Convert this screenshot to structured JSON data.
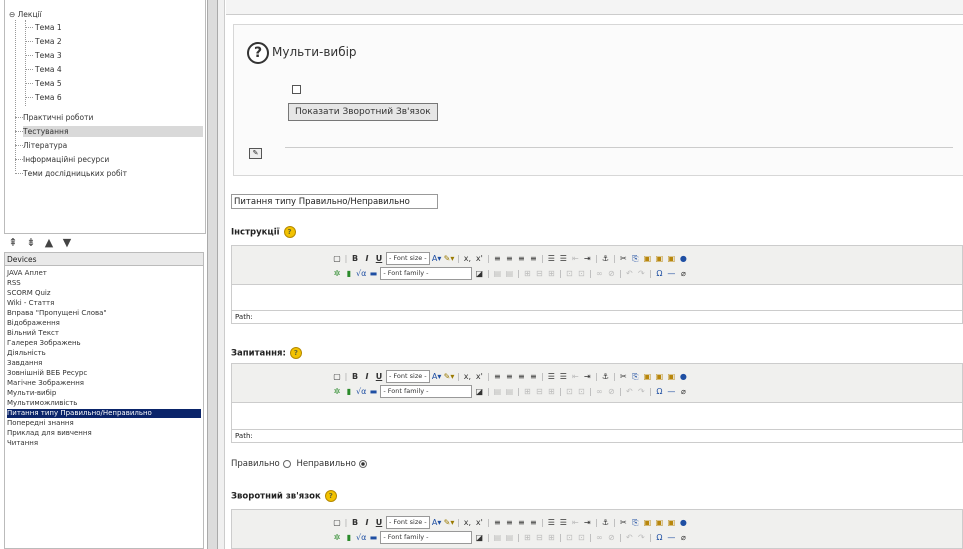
{
  "tree": {
    "root": "Лекції",
    "topics": [
      "Тема 1",
      "Тема 2",
      "Тема 3",
      "Тема 4",
      "Тема 5",
      "Тема 6"
    ],
    "sections": [
      "Практичні роботи",
      "Тестування",
      "Література",
      "Інформаційні ресурси",
      "Теми дослідницьких робіт"
    ],
    "selected": "Тестування"
  },
  "arrows": [
    "⇞",
    "⇟",
    "▲",
    "▼"
  ],
  "devices": {
    "header": "Devices",
    "items": [
      "JAVA Аплет",
      "RSS",
      "SCORM Quiz",
      "Wiki - Стаття",
      "Вправа \"Пропущені Слова\"",
      "Відображення",
      "Вільний Текст",
      "Галерея Зображень",
      "Діяльність",
      "Завдання",
      "Зовнішній ВЕБ Ресурс",
      "Магічне Зображення",
      "Мульти-вибір",
      "Мультиможливість",
      "Питання типу Правильно/Неправильно",
      "Попередні знання",
      "Приклад для вивчення",
      "Читання"
    ],
    "selected": "Питання типу Правильно/Неправильно"
  },
  "preview": {
    "icon": "?",
    "title": "Мульти-вибір",
    "feedback_button": "Показати Зворотний Зв'язок"
  },
  "question_title": "Питання типу Правильно/Неправильно",
  "sections": {
    "instructions": "Інструкції",
    "question": "Запитання:",
    "feedback": "Зворотний зв'язок"
  },
  "editor": {
    "font_size": "- Font size -",
    "font_family": "- Font family -",
    "path": "Path:"
  },
  "answer": {
    "true_label": "Правильно",
    "false_label": "Неправильно",
    "selected": "false"
  }
}
